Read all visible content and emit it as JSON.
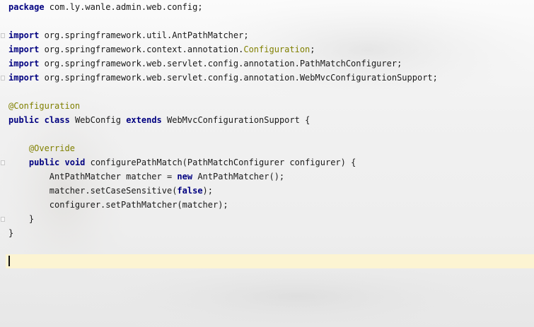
{
  "editor": {
    "lines": [
      {
        "tokens": [
          {
            "t": "kw",
            "v": "package"
          },
          {
            "t": "txt",
            "v": " com.ly.wanle.admin.web.config;"
          }
        ]
      },
      {
        "tokens": []
      },
      {
        "tokens": [
          {
            "t": "kw",
            "v": "import"
          },
          {
            "t": "txt",
            "v": " org.springframework.util.AntPathMatcher;"
          }
        ]
      },
      {
        "tokens": [
          {
            "t": "kw",
            "v": "import"
          },
          {
            "t": "txt",
            "v": " org.springframework.context.annotation."
          },
          {
            "t": "cls-hl",
            "v": "Configuration"
          },
          {
            "t": "txt",
            "v": ";"
          }
        ]
      },
      {
        "tokens": [
          {
            "t": "kw",
            "v": "import"
          },
          {
            "t": "txt",
            "v": " org.springframework.web.servlet.config.annotation.PathMatchConfigurer;"
          }
        ]
      },
      {
        "tokens": [
          {
            "t": "kw",
            "v": "import"
          },
          {
            "t": "txt",
            "v": " org.springframework.web.servlet.config.annotation.WebMvcConfigurationSupport;"
          }
        ]
      },
      {
        "tokens": []
      },
      {
        "tokens": [
          {
            "t": "ann",
            "v": "@Configuration"
          }
        ]
      },
      {
        "tokens": [
          {
            "t": "kw",
            "v": "public"
          },
          {
            "t": "txt",
            "v": " "
          },
          {
            "t": "kw",
            "v": "class"
          },
          {
            "t": "txt",
            "v": " WebConfig "
          },
          {
            "t": "kw",
            "v": "extends"
          },
          {
            "t": "txt",
            "v": " WebMvcConfigurationSupport {"
          }
        ]
      },
      {
        "tokens": []
      },
      {
        "tokens": [
          {
            "t": "txt",
            "v": "    "
          },
          {
            "t": "ann",
            "v": "@Override"
          }
        ]
      },
      {
        "tokens": [
          {
            "t": "txt",
            "v": "    "
          },
          {
            "t": "kw",
            "v": "public"
          },
          {
            "t": "txt",
            "v": " "
          },
          {
            "t": "kw",
            "v": "void"
          },
          {
            "t": "txt",
            "v": " configurePathMatch(PathMatchConfigurer configurer) {"
          }
        ]
      },
      {
        "tokens": [
          {
            "t": "txt",
            "v": "        AntPathMatcher matcher = "
          },
          {
            "t": "kw",
            "v": "new"
          },
          {
            "t": "txt",
            "v": " AntPathMatcher();"
          }
        ]
      },
      {
        "tokens": [
          {
            "t": "txt",
            "v": "        matcher.setCaseSensitive("
          },
          {
            "t": "kw",
            "v": "false"
          },
          {
            "t": "txt",
            "v": ");"
          }
        ]
      },
      {
        "tokens": [
          {
            "t": "txt",
            "v": "        configurer.setPathMatcher(matcher);"
          }
        ]
      },
      {
        "tokens": [
          {
            "t": "txt",
            "v": "    }"
          }
        ]
      },
      {
        "tokens": [
          {
            "t": "txt",
            "v": "}"
          }
        ]
      },
      {
        "tokens": []
      },
      {
        "tokens": []
      }
    ],
    "caret_line": 19,
    "fold_marker_lines": [
      3,
      6,
      12,
      16
    ]
  },
  "colors": {
    "keyword": "#000080",
    "annotation": "#808000",
    "current_line": "#fff6ce"
  }
}
